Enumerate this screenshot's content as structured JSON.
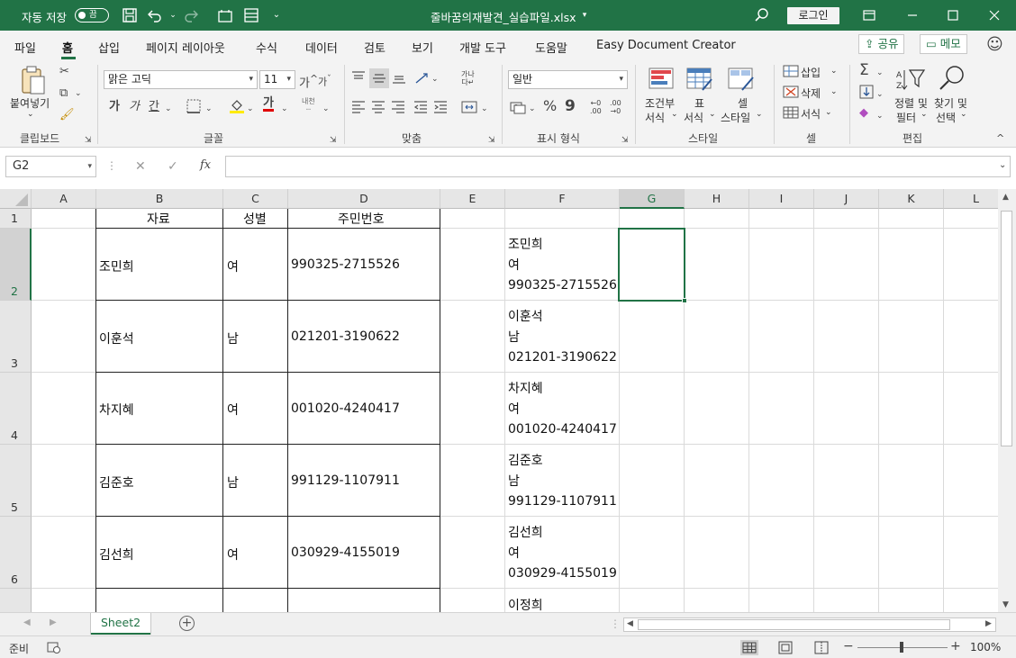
{
  "titlebar": {
    "autosave_label": "자동 저장",
    "autosave_state": "끔",
    "file_name": "줄바꿈의재발견_실습파일.xlsx",
    "login_label": "로그인"
  },
  "menu": {
    "tabs": [
      "파일",
      "홈",
      "삽입",
      "페이지 레이아웃",
      "수식",
      "데이터",
      "검토",
      "보기",
      "개발 도구",
      "도움말",
      "Easy Document Creator"
    ],
    "active": "홈",
    "share_label": "공유",
    "memo_label": "메모"
  },
  "ribbon": {
    "clipboard": {
      "paste_label": "붙여넣기",
      "group": "클립보드"
    },
    "font": {
      "font_name": "맑은 고딕",
      "font_size": "11",
      "group": "글꼴",
      "bold": "가",
      "italic": "가",
      "underline": "간",
      "font_color_glyph": "가",
      "increase": "가",
      "decrease": "가"
    },
    "align": {
      "group": "맞춤"
    },
    "number": {
      "format": "일반",
      "group": "표시 형식"
    },
    "styles": {
      "cond_format_1": "조건부",
      "cond_format_2": "서식",
      "table_1": "표",
      "table_2": "서식",
      "cell_1": "셀",
      "cell_2": "스타일",
      "group": "스타일"
    },
    "cells": {
      "insert": "삽입",
      "delete": "삭제",
      "format": "서식",
      "group": "셀"
    },
    "edit": {
      "sort_1": "정렬 및",
      "sort_2": "필터",
      "find_1": "찾기 및",
      "find_2": "선택",
      "group": "편집"
    }
  },
  "formula_bar": {
    "name_box": "G2",
    "fx": "fx",
    "formula": ""
  },
  "sheet": {
    "columns": [
      "A",
      "B",
      "C",
      "D",
      "E",
      "F",
      "G",
      "H",
      "I",
      "J",
      "K",
      "L"
    ],
    "selected_column": "G",
    "rows": [
      "1",
      "2",
      "3",
      "4",
      "5",
      "6"
    ],
    "selected_row": "2",
    "headers": [
      "자료",
      "성별",
      "주민번호"
    ],
    "records": [
      {
        "name": "조민희",
        "gender": "여",
        "id": "990325-2715526"
      },
      {
        "name": "이훈석",
        "gender": "남",
        "id": "021201-3190622"
      },
      {
        "name": "차지혜",
        "gender": "여",
        "id": "001020-4240417"
      },
      {
        "name": "김준호",
        "gender": "남",
        "id": "991129-1107911"
      },
      {
        "name": "김선희",
        "gender": "여",
        "id": "030929-4155019"
      }
    ],
    "partial_name": "이정희"
  },
  "sheet_tabs": {
    "active": "Sheet2"
  },
  "status": {
    "ready": "준비",
    "zoom": "100%"
  },
  "colors": {
    "accent": "#217346",
    "titlebar": "#217346"
  }
}
